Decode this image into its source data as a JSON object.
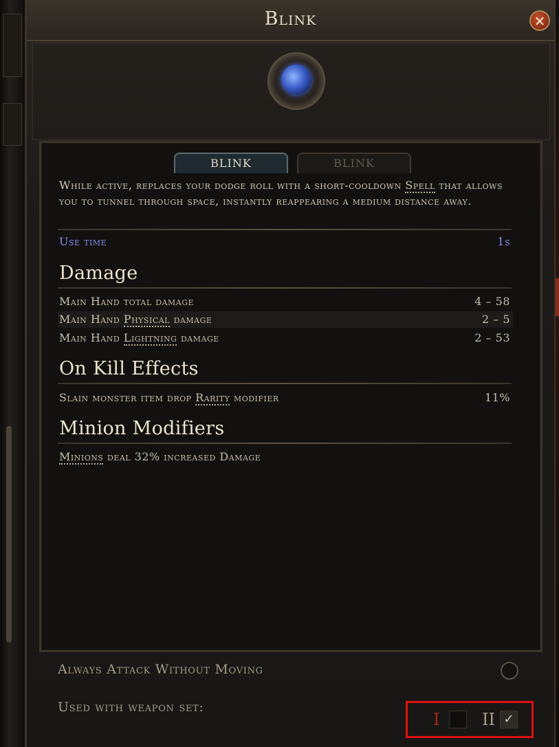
{
  "window": {
    "title": "Blink",
    "close_symbol": "✕"
  },
  "skill_icon": "blink-gem-icon",
  "tabs": [
    {
      "label": "BLINK",
      "active": true
    },
    {
      "label": "BLINK",
      "active": false
    }
  ],
  "description": {
    "part1": "While active, replaces your dodge roll with a short-cooldown ",
    "keyword": "Spell",
    "part2": " that allows you to tunnel through space, instantly reappearing a medium distance away."
  },
  "use_time": {
    "label": "Use time",
    "value": "1s"
  },
  "damage": {
    "heading": "Damage",
    "rows": [
      {
        "pre": "Main Hand total damage",
        "kw": "",
        "post": "",
        "value": "4 – 58"
      },
      {
        "pre": "Main Hand ",
        "kw": "Physical",
        "post": " damage",
        "value": "2 – 5"
      },
      {
        "pre": "Main Hand ",
        "kw": "Lightning",
        "post": " damage",
        "value": "2 – 53"
      }
    ]
  },
  "on_kill": {
    "heading": "On Kill Effects",
    "row": {
      "pre": "Slain monster item drop ",
      "kw": "Rarity",
      "post": " modifier",
      "value": "11%"
    }
  },
  "minion": {
    "heading": "Minion Modifiers",
    "row": {
      "kw": "Minions",
      "post": " deal 32% increased Damage"
    }
  },
  "footer": {
    "always_attack_label": "Always Attack Without Moving",
    "always_attack_enabled": false,
    "weapon_set_label": "Used with weapon set:",
    "set_one": "I",
    "set_two": "II",
    "set_one_checked": false,
    "set_two_checked": true,
    "check_symbol": "✓"
  },
  "colors": {
    "accent_blue": "#8a8ef0",
    "highlight_red": "#e01010"
  }
}
